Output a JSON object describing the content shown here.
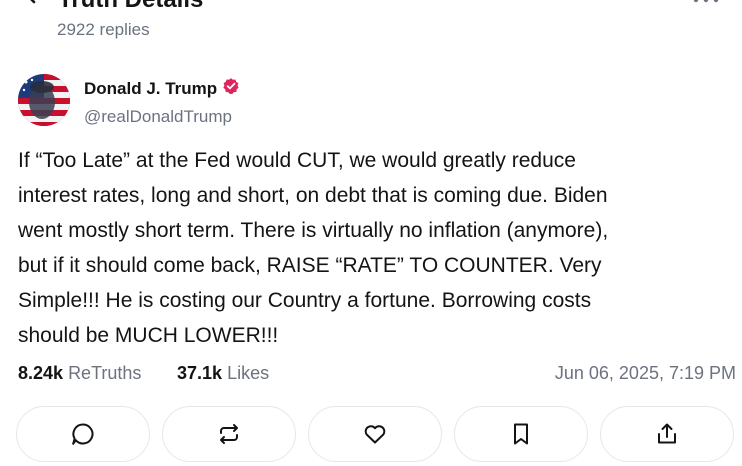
{
  "header": {
    "title": "Truth Details",
    "reply_count": "2922 replies"
  },
  "author": {
    "display_name": "Donald J. Trump",
    "handle": "@realDonaldTrump",
    "verified_color": "#e0245e"
  },
  "post": {
    "lines": [
      "If “Too Late” at the Fed would CUT, we would greatly reduce",
      "interest rates, long and short, on debt that is coming due. Biden",
      "went mostly short term. There is virtually no inflation (anymore),",
      "but if it should come back, RAISE “RATE” TO COUNTER. Very",
      "Simple!!! He is costing our Country a fortune. Borrowing costs",
      "should be MUCH LOWER!!!"
    ]
  },
  "stats": {
    "retruths_count": "8.24k",
    "retruths_label": "ReTruths",
    "likes_count": "37.1k",
    "likes_label": "Likes",
    "timestamp": "Jun 06, 2025, 7:19 PM"
  },
  "actions": [
    {
      "icon": "reply-icon"
    },
    {
      "icon": "retruth-icon"
    },
    {
      "icon": "heart-icon"
    },
    {
      "icon": "bookmark-icon"
    },
    {
      "icon": "share-icon"
    }
  ]
}
